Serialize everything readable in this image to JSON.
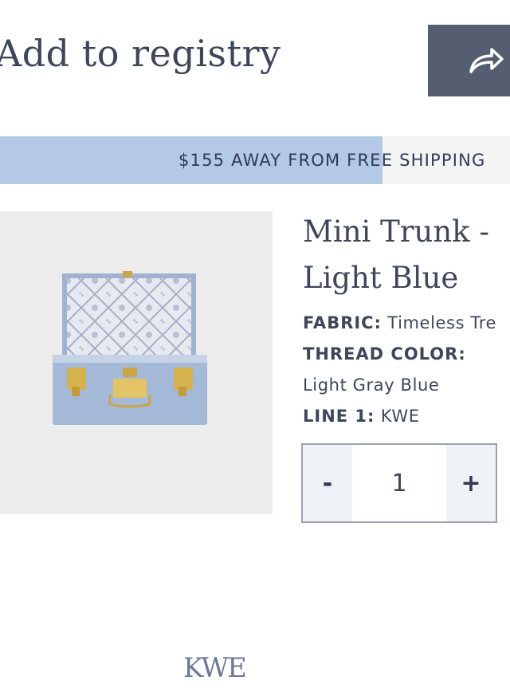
{
  "header": {
    "title": "Add to registry",
    "share_icon": "share-arrow-icon"
  },
  "shipping": {
    "message": "$155 AWAY FROM FREE SHIPPING",
    "progress_percent": 75,
    "fill_color": "#b3c9e6"
  },
  "product": {
    "name": "Mini Trunk - Light Blue",
    "monogram": "KWE",
    "fabric_label": "FABRIC:",
    "fabric_value": "Timeless Tre",
    "thread_label": "THREAD COLOR:",
    "thread_value": "Light Gray Blue",
    "line1_label": "LINE 1:",
    "line1_value": "KWE"
  },
  "quantity": {
    "minus": "-",
    "value": "1",
    "plus": "+"
  },
  "colors": {
    "accent_dark": "#555d70",
    "text": "#3f465a"
  }
}
